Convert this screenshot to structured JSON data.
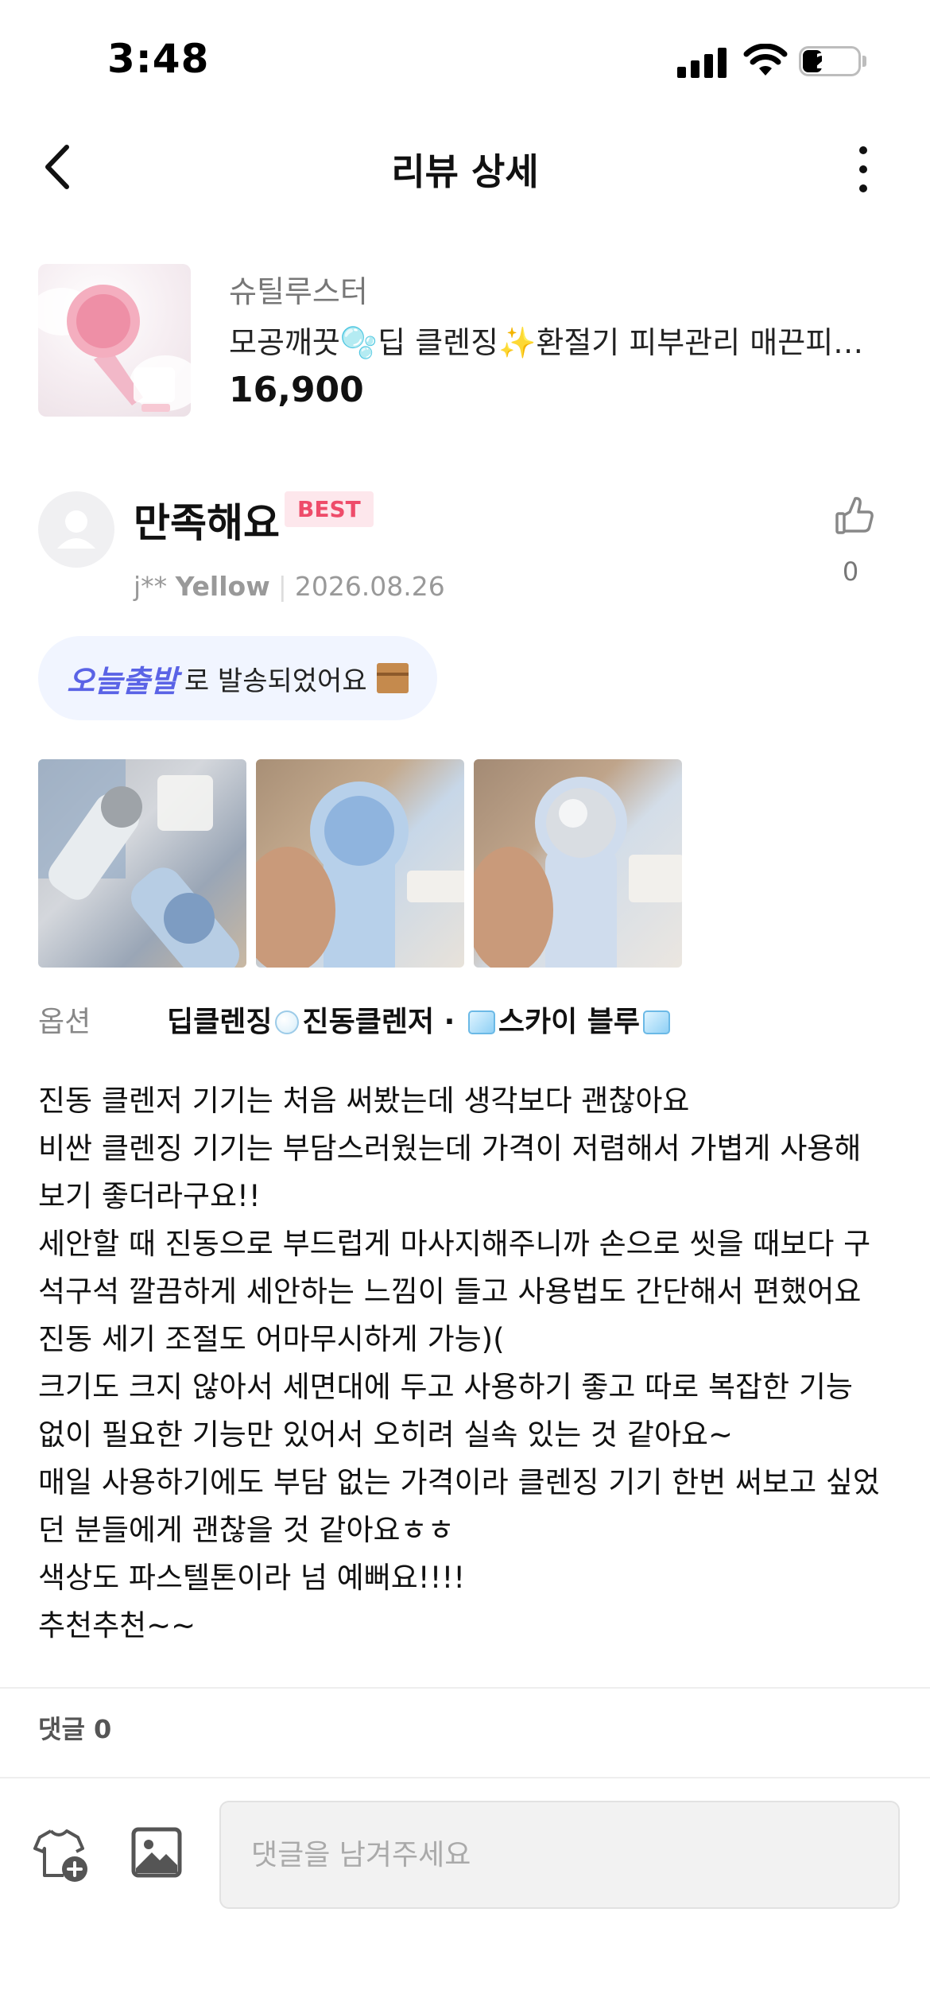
{
  "status_bar": {
    "time": "3:48",
    "battery": "23"
  },
  "nav": {
    "title": "리뷰 상세"
  },
  "product": {
    "brand": "슈틸루스터",
    "name": "모공깨끗🫧딥 클렌징✨환절기 피부관리 매끈피부 ...",
    "price": "16,900"
  },
  "review": {
    "rating_text": "만족해요",
    "badge": "BEST",
    "like_count": "0",
    "reviewer_id": "j**",
    "reviewer_grade": "Yellow",
    "date": "2026.08.26",
    "shipping": {
      "brand": "오늘출발",
      "text": "로 발송되었어요"
    },
    "option": {
      "label": "옵션",
      "part1": "딥클렌징",
      "part2": "진동클렌저 · ",
      "part3": "스카이 블루"
    },
    "body_lines": [
      "진동 클렌저 기기는 처음 써봤는데 생각보다 괜찮아요",
      "비싼 클렌징 기기는 부담스러웠는데 가격이 저렴해서 가볍게 사용해",
      "보기 좋더라구요!!",
      "세안할 때 진동으로 부드럽게 마사지해주니까 손으로 씻을 때보다 구",
      "석구석 깔끔하게 세안하는 느낌이 들고 사용법도 간단해서 편했어요",
      "진동 세기 조절도 어마무시하게 가능)(",
      "크기도 크지 않아서 세면대에 두고 사용하기 좋고 따로 복잡한 기능",
      "없이 필요한 기능만 있어서 오히려 실속 있는 것 같아요~",
      "매일 사용하기에도 부담 없는 가격이라 클렌징 기기 한번 써보고 싶었",
      "던 분들에게 괜찮을 것 같아요ㅎㅎ",
      "색상도 파스텔톤이라 넘 예뻐요!!!!",
      "추천추천~~"
    ]
  },
  "comments": {
    "count_label": "댓글 0",
    "placeholder": "댓글을 남겨주세요"
  },
  "icons": {
    "back": "chevron-left-icon",
    "more": "more-vertical-icon",
    "like": "thumbs-up-icon",
    "tshirt": "tshirt-plus-icon",
    "image": "image-icon"
  }
}
